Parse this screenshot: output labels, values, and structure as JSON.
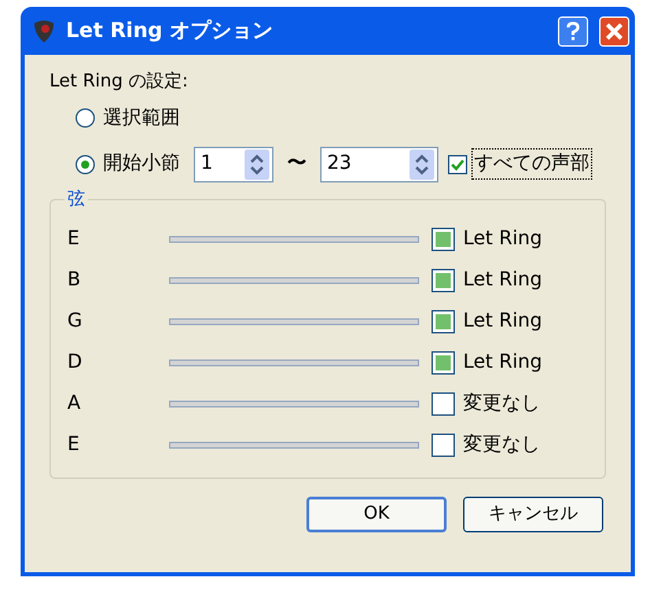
{
  "window": {
    "title": "Let Ring オプション"
  },
  "settings_label": "Let Ring の設定:",
  "range_options": [
    {
      "label": "選択範囲",
      "selected": false
    },
    {
      "label": "開始小節",
      "selected": true
    }
  ],
  "start_bar": "1",
  "range_separator": "〜",
  "end_bar": "23",
  "all_parts": {
    "label": "すべての声部",
    "checked": true
  },
  "strings_group": {
    "title": "弦",
    "strings": [
      {
        "name": "E",
        "checked": true,
        "label": "Let Ring"
      },
      {
        "name": "B",
        "checked": true,
        "label": "Let Ring"
      },
      {
        "name": "G",
        "checked": true,
        "label": "Let Ring"
      },
      {
        "name": "D",
        "checked": true,
        "label": "Let Ring"
      },
      {
        "name": "A",
        "checked": false,
        "label": "変更なし"
      },
      {
        "name": "E",
        "checked": false,
        "label": "変更なし"
      }
    ]
  },
  "buttons": [
    {
      "label": "OK",
      "kind": "default"
    },
    {
      "label": "キャンセル",
      "kind": "normal"
    }
  ]
}
